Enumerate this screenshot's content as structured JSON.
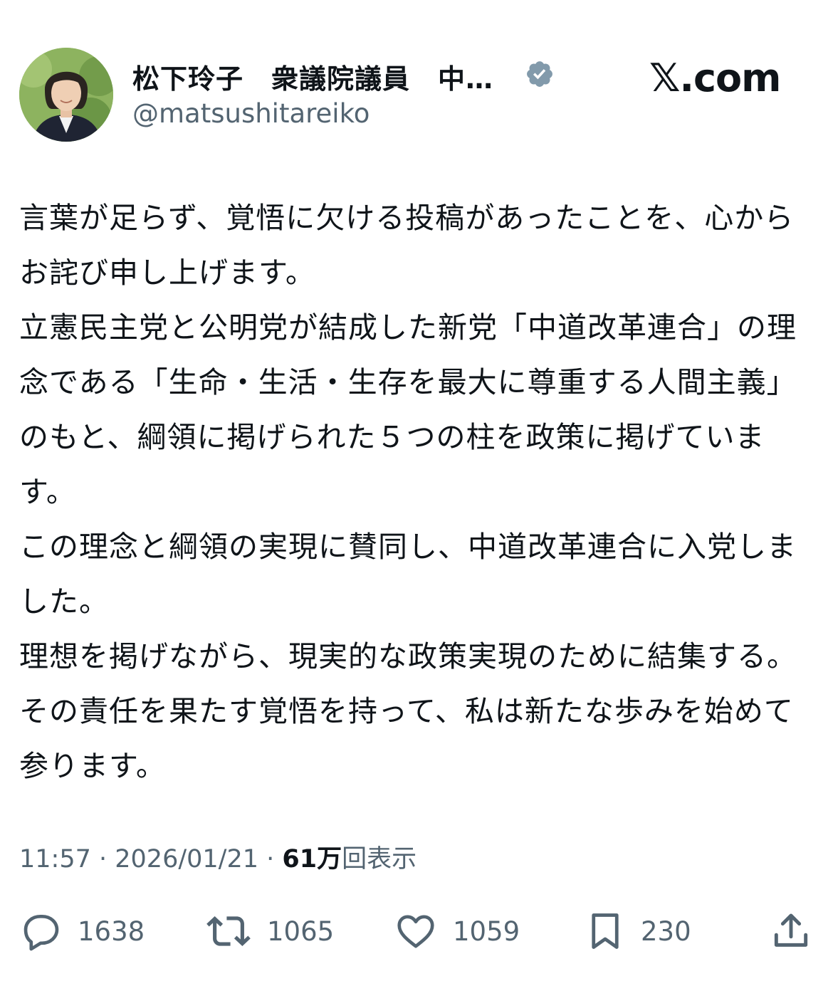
{
  "author": {
    "display_name": "松下玲子　衆議院議員　中…",
    "handle": "@matsushitareiko",
    "verified": true,
    "avatar": "profile-photo"
  },
  "site": {
    "brand": "𝕏.com"
  },
  "tweet": {
    "paragraphs": [
      "言葉が足らず、覚悟に欠ける投稿があったことを、心からお詫び申し上げます。",
      "立憲民主党と公明党が結成した新党「中道改革連合」の理念である「生命・生活・生存を最大に尊重する人間主義」のもと、綱領に掲げられた５つの柱を政策に掲げています。",
      "この理念と綱領の実現に賛同し、中道改革連合に入党しました。",
      "理想を掲げながら、現実的な政策実現のために結集する。その責任を果たす覚悟を持って、私は新たな歩みを始めて参ります。"
    ]
  },
  "meta": {
    "time": "11:57",
    "separator": " · ",
    "date": "2026/01/21",
    "views_count": "61万",
    "views_label": "回表示"
  },
  "actions": {
    "replies": "1638",
    "reposts": "1065",
    "likes": "1059",
    "bookmarks": "230"
  },
  "colors": {
    "text": "#0f1419",
    "secondary": "#536471",
    "verified_badge": "#829aab"
  },
  "icons": [
    "verified-badge-icon",
    "reply-icon",
    "repost-icon",
    "like-icon",
    "bookmark-icon",
    "share-icon"
  ]
}
